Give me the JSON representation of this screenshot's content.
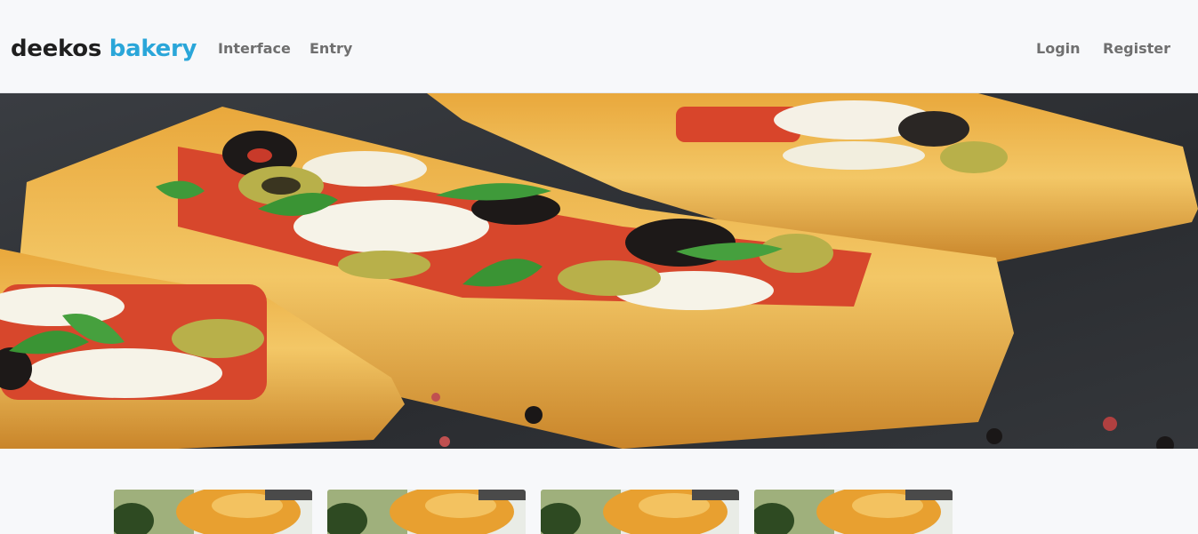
{
  "brand": {
    "part1": "deekos",
    "part2": "bakery"
  },
  "nav": {
    "left": [
      "Interface",
      "Entry"
    ],
    "right": [
      "Login",
      "Register"
    ]
  },
  "colors": {
    "accent": "#2aa6d9",
    "nav_text": "#6f6f6f",
    "background": "#f7f8fa"
  },
  "hero": {
    "image": "pizza-puff-pastry-photo"
  },
  "cards": [
    {
      "image": "spinach-pastry-photo"
    },
    {
      "image": "spinach-pastry-photo"
    },
    {
      "image": "spinach-pastry-photo"
    },
    {
      "image": "spinach-pastry-photo"
    }
  ]
}
